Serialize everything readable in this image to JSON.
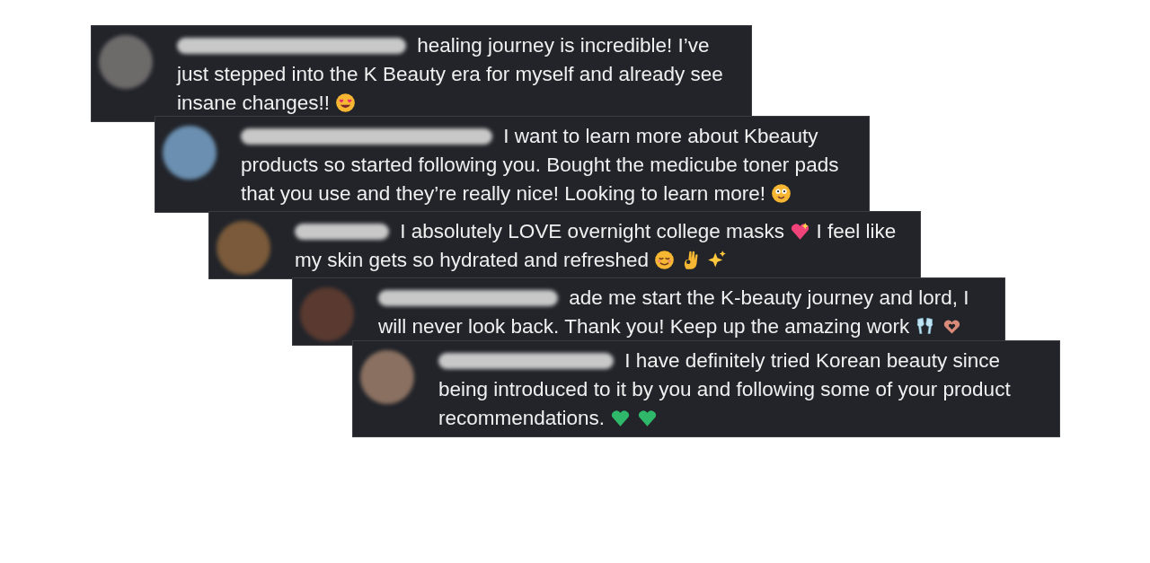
{
  "comments": [
    {
      "segments": [
        {
          "kind": "text",
          "text": "healing journey is incredible! I’ve just stepped into the K Beauty era for myself and already see insane changes!!"
        },
        {
          "kind": "hearteyes"
        }
      ]
    },
    {
      "segments": [
        {
          "kind": "text",
          "text": "I want to learn more about Kbeauty products so started following you. Bought the medicube toner pads that you use and they’re really nice! Looking to learn more!"
        },
        {
          "kind": "smiley"
        }
      ]
    },
    {
      "segments": [
        {
          "kind": "text",
          "text": "I absolutely LOVE overnight college masks"
        },
        {
          "kind": "sparkleheart"
        },
        {
          "kind": "text",
          "text": "I feel like my skin gets so hydrated and refreshed"
        },
        {
          "kind": "relieved"
        },
        {
          "kind": "okhand"
        },
        {
          "kind": "sparkles"
        }
      ]
    },
    {
      "segments": [
        {
          "kind": "text",
          "text": "ade me start the K-beauty journey and lord, I will never look back. Thank you! Keep up the amazing work"
        },
        {
          "kind": "clink"
        },
        {
          "kind": "hearthands"
        }
      ]
    },
    {
      "segments": [
        {
          "kind": "text",
          "text": "I have definitely tried Korean beauty since being introduced to it by you and following some of your product recommendations."
        },
        {
          "kind": "greenheart"
        },
        {
          "kind": "greenheart"
        }
      ]
    }
  ]
}
